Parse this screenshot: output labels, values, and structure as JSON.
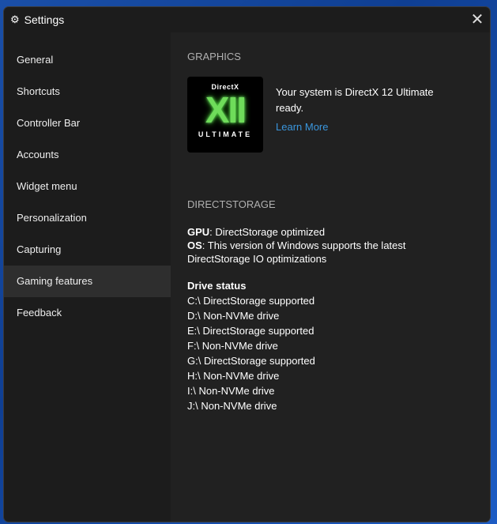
{
  "window": {
    "title": "Settings",
    "close": "✕"
  },
  "sidebar": {
    "items": [
      {
        "label": "General"
      },
      {
        "label": "Shortcuts"
      },
      {
        "label": "Controller Bar"
      },
      {
        "label": "Accounts"
      },
      {
        "label": "Widget menu"
      },
      {
        "label": "Personalization"
      },
      {
        "label": "Capturing"
      },
      {
        "label": "Gaming features",
        "selected": true
      },
      {
        "label": "Feedback"
      }
    ]
  },
  "graphics": {
    "heading": "GRAPHICS",
    "logo_top": "DirectX",
    "logo_mid": "XII",
    "logo_bottom": "ULTIMATE",
    "status": "Your system is DirectX 12 Ultimate ready.",
    "link": "Learn More"
  },
  "directstorage": {
    "heading": "DIRECTSTORAGE",
    "gpu_label": "GPU",
    "gpu_value": ": DirectStorage optimized",
    "os_label": "OS",
    "os_value": ": This version of Windows supports the latest DirectStorage IO optimizations",
    "drive_heading": "Drive status",
    "drives": [
      "C:\\ DirectStorage supported",
      "D:\\ Non-NVMe drive",
      "E:\\ DirectStorage supported",
      "F:\\ Non-NVMe drive",
      "G:\\ DirectStorage supported",
      "H:\\ Non-NVMe drive",
      "I:\\ Non-NVMe drive",
      "J:\\ Non-NVMe drive"
    ]
  }
}
